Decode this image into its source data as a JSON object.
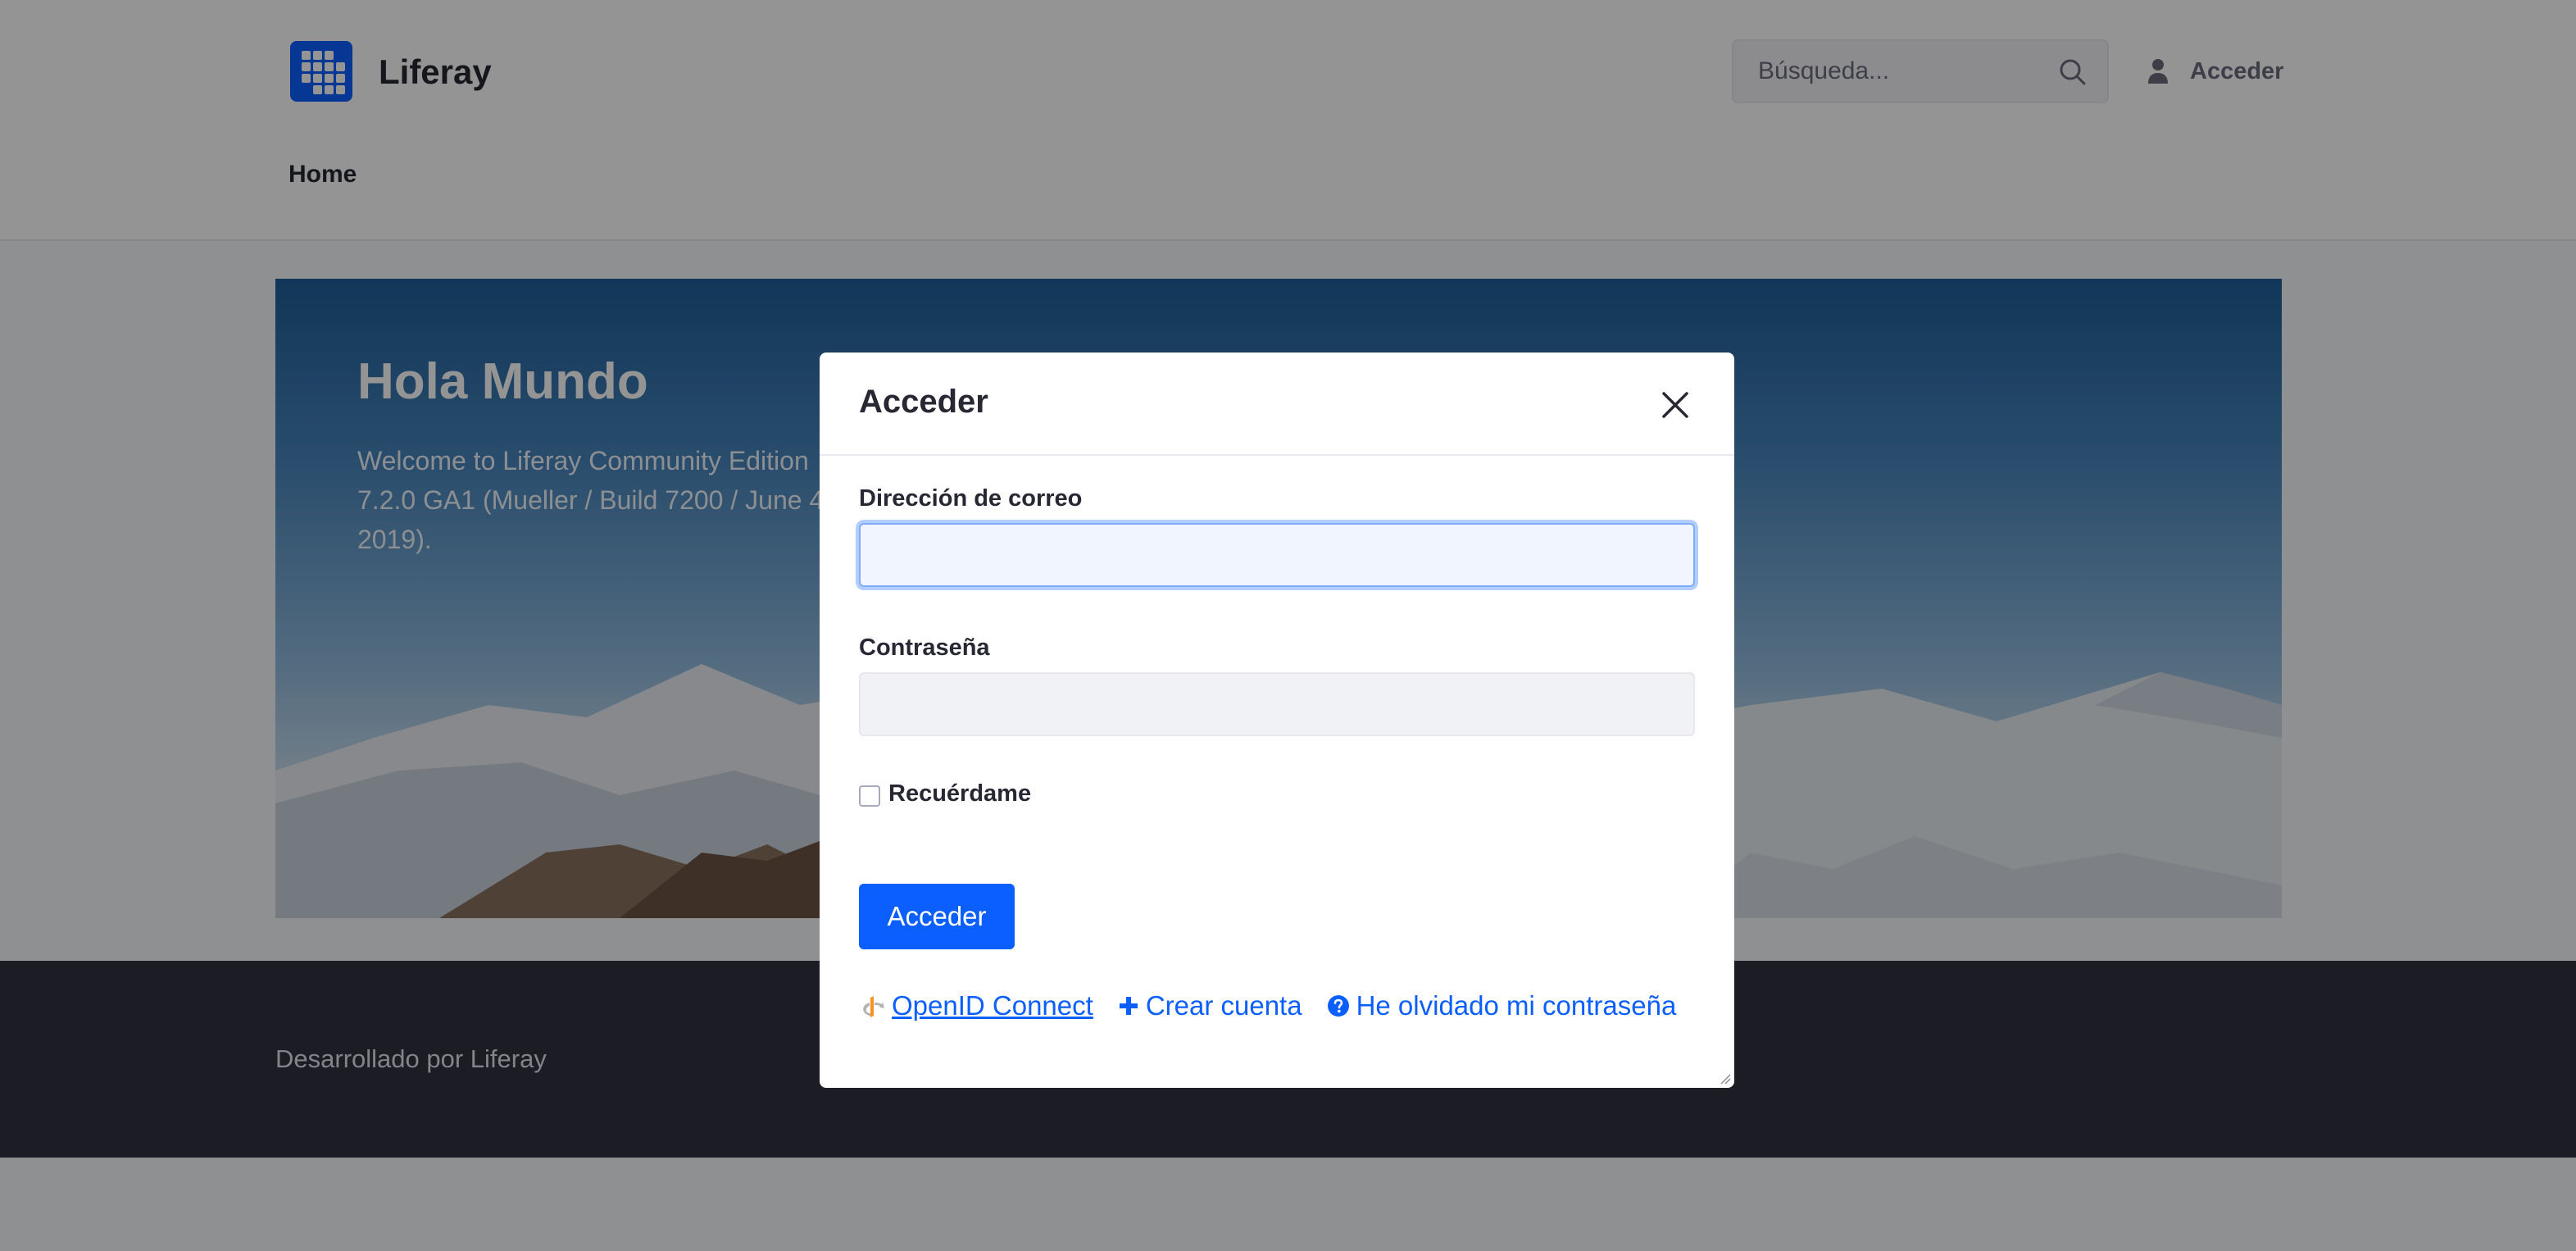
{
  "header": {
    "brand": "Liferay",
    "search_placeholder": "Búsqueda...",
    "signin_label": "Acceder",
    "nav": [
      {
        "label": "Home"
      }
    ]
  },
  "hero": {
    "title": "Hola Mundo",
    "text": "Welcome to Liferay Community Edition 7.2.0 GA1 (Mueller / Build 7200 / June 4, 2019)."
  },
  "footer": {
    "text": "Desarrollado por Liferay"
  },
  "modal": {
    "title": "Acceder",
    "email_label": "Dirección de correo",
    "email_value": "",
    "password_label": "Contraseña",
    "password_value": "",
    "remember_label": "Recuérdame",
    "remember_checked": false,
    "submit_label": "Acceder",
    "links": {
      "openid": "OpenID Connect",
      "create_account": "Crear cuenta",
      "forgot_password": "He olvidado mi contraseña"
    }
  },
  "colors": {
    "primary": "#0b5fff",
    "footer_bg": "#30313f",
    "text": "#272833"
  },
  "icons": [
    "search-icon",
    "user-icon",
    "close-icon",
    "openid-icon",
    "plus-icon",
    "question-circle-icon"
  ]
}
